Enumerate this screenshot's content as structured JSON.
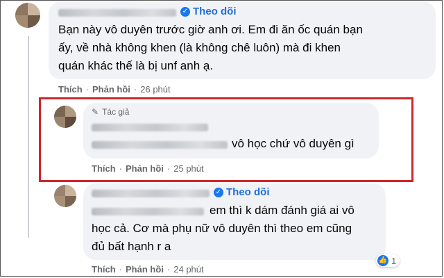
{
  "comments": [
    {
      "follow_label": "Theo dõi",
      "body_lines": [
        "Bạn này vô duyên trước giờ anh ơi. Em đi ăn ốc quán bạn",
        "ấy, về nhà không khen (là không chê luôn) mà đi khen",
        "quán khác thế là bị unf anh ạ."
      ],
      "actions": {
        "like": "Thích",
        "reply": "Phản hồi",
        "time": "26 phút"
      }
    },
    {
      "author_tag": "Tác giả",
      "body_text": "vô học chứ vô duyên gì",
      "actions": {
        "like": "Thích",
        "reply": "Phản hồi",
        "time": "25 phút"
      }
    },
    {
      "follow_label": "Theo dõi",
      "body_lines": [
        "em thì k dám đánh giá ai vô",
        "học cả. Cơ mà phụ nữ vô duyên thì theo em cũng",
        "đủ bất hạnh r a"
      ],
      "actions": {
        "like": "Thích",
        "reply": "Phản hồi",
        "time": "24 phút"
      },
      "reaction_count": "1"
    }
  ],
  "separator": "·",
  "colors": {
    "highlight_border": "#d0262c",
    "link_blue": "#216fdb",
    "bubble_bg": "#f0f2f5",
    "meta_gray": "#65676b"
  },
  "icons": {
    "verified": "check-badge",
    "author": "pencil",
    "reaction": "thumbs-up"
  }
}
